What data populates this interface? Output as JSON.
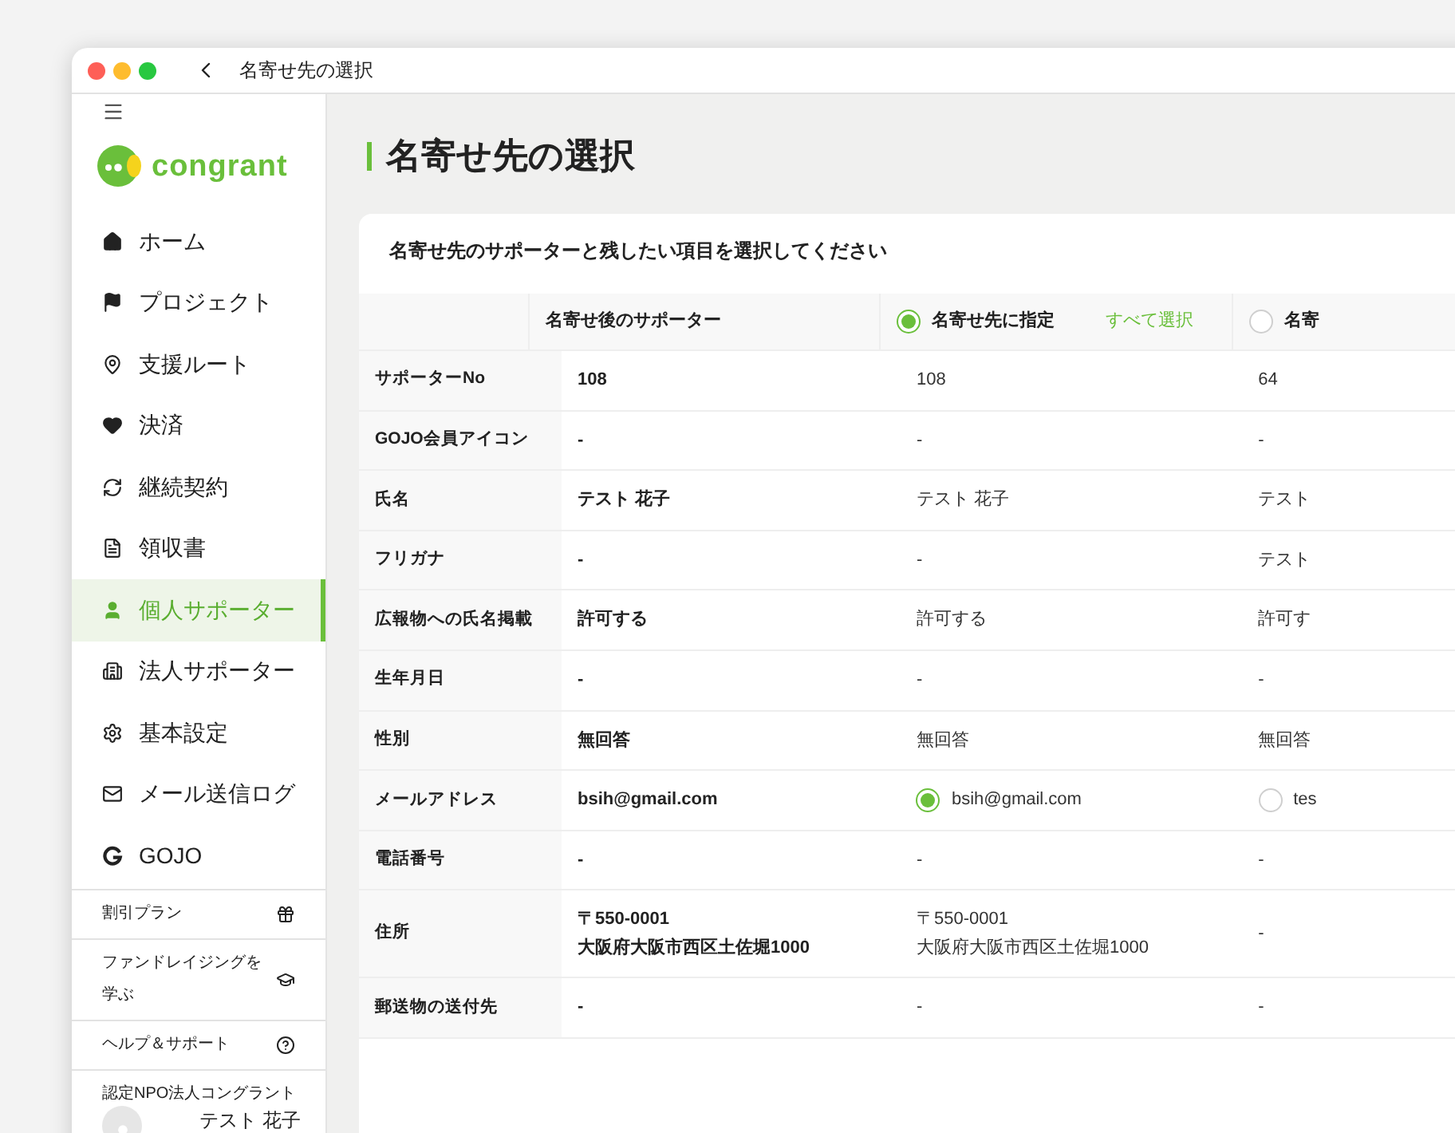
{
  "window": {
    "title": "名寄せ先の選択"
  },
  "sidebar": {
    "logo": "congrant",
    "items": [
      {
        "label": "ホーム",
        "selected": false
      },
      {
        "label": "プロジェクト",
        "selected": false
      },
      {
        "label": "支援ルート",
        "selected": false
      },
      {
        "label": "決済",
        "selected": false
      },
      {
        "label": "継続契約",
        "selected": false
      },
      {
        "label": "領収書",
        "selected": false
      },
      {
        "label": "個人サポーター",
        "selected": true
      },
      {
        "label": "法人サポーター",
        "selected": false
      },
      {
        "label": "基本設定",
        "selected": false
      },
      {
        "label": "メール送信ログ",
        "selected": false
      },
      {
        "label": "GOJO",
        "selected": false
      }
    ],
    "links": [
      {
        "label": "割引プラン"
      },
      {
        "label": "ファンドレイジングを学ぶ"
      },
      {
        "label": "ヘルプ＆サポート"
      }
    ],
    "organization": "認定NPO法人コングラント",
    "user_name": "テスト 花子"
  },
  "page": {
    "heading": "名寄せ先の選択",
    "instruction": "名寄せ先のサポーターと残したい項目を選択してください"
  },
  "table": {
    "columns": [
      {
        "label": "名寄せ後のサポーター"
      },
      {
        "label": "名寄せ先に指定",
        "selected": true,
        "link": "すべて選択"
      },
      {
        "label": "名寄",
        "selected": false
      }
    ],
    "rows": [
      {
        "label": "サポーターNo",
        "cells": [
          {
            "text": "108"
          },
          {
            "text": "108"
          },
          {
            "text": "64"
          }
        ]
      },
      {
        "label": "GOJO会員アイコン",
        "cells": [
          {
            "text": "-"
          },
          {
            "text": "-"
          },
          {
            "text": "-"
          }
        ]
      },
      {
        "label": "氏名",
        "cells": [
          {
            "text": "テスト 花子"
          },
          {
            "text": "テスト 花子"
          },
          {
            "text": "テスト"
          }
        ]
      },
      {
        "label": "フリガナ",
        "cells": [
          {
            "text": "-"
          },
          {
            "text": "-"
          },
          {
            "text": "テスト"
          }
        ]
      },
      {
        "label": "広報物への氏名掲載",
        "cells": [
          {
            "text": "許可する"
          },
          {
            "text": "許可する"
          },
          {
            "text": "許可す"
          }
        ]
      },
      {
        "label": "生年月日",
        "cells": [
          {
            "text": "-"
          },
          {
            "text": "-"
          },
          {
            "text": "-"
          }
        ]
      },
      {
        "label": "性別",
        "cells": [
          {
            "text": "無回答"
          },
          {
            "text": "無回答"
          },
          {
            "text": "無回答"
          }
        ]
      },
      {
        "label": "メールアドレス",
        "cells": [
          {
            "text": "bsih@gmail.com"
          },
          {
            "text": "bsih@gmail.com",
            "selected": true
          },
          {
            "text": "tes",
            "selected": false
          }
        ]
      },
      {
        "label": "電話番号",
        "cells": [
          {
            "text": "-"
          },
          {
            "text": "-"
          },
          {
            "text": "-"
          }
        ]
      },
      {
        "label": "住所",
        "cells": [
          {
            "lines": [
              "〒550-0001",
              "大阪府大阪市西区土佐堀1000"
            ]
          },
          {
            "lines": [
              "〒550-0001",
              "大阪府大阪市西区土佐堀1000"
            ]
          },
          {
            "text": "-"
          }
        ]
      },
      {
        "label": "郵送物の送付先",
        "cells": [
          {
            "text": "-"
          },
          {
            "text": "-"
          },
          {
            "text": "-"
          }
        ]
      }
    ]
  }
}
